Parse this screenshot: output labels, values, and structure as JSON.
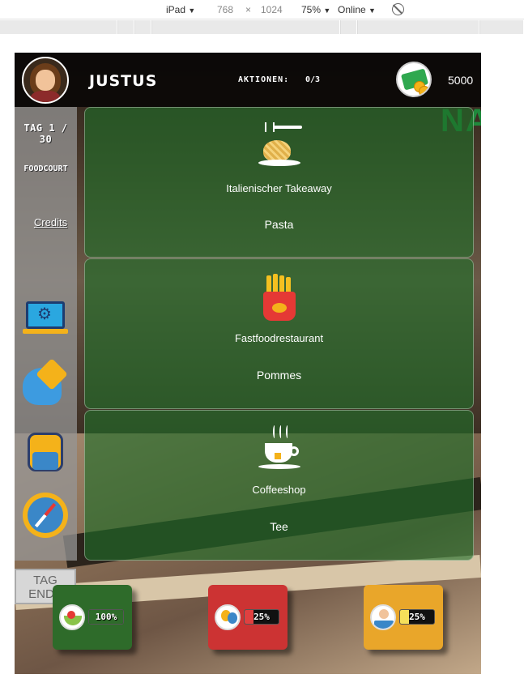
{
  "devtools": {
    "device": "iPad",
    "width": "768",
    "times": "×",
    "height": "1024",
    "zoom": "75%",
    "network": "Online",
    "dropdown_glyph": "▼"
  },
  "header": {
    "player_name": "JUSTUS",
    "actions_label": "AKTIONEN:",
    "actions_value": "0/3",
    "money": "5000"
  },
  "sidebar": {
    "day": "TAG 1 / 30",
    "location": "FOODCOURT",
    "credits": "Credits",
    "icons": [
      "settings-laptop-icon",
      "brain-icon",
      "backpack-icon",
      "compass-icon"
    ],
    "end_day_line1": "TAG",
    "end_day_line2": "ENDE"
  },
  "shops": [
    {
      "name": "Italienischer Takeaway",
      "product": "Pasta",
      "icon": "pasta-icon"
    },
    {
      "name": "Fastfoodrestaurant",
      "product": "Pommes",
      "icon": "fries-icon"
    },
    {
      "name": "Coffeeshop",
      "product": "Tee",
      "icon": "coffee-icon"
    }
  ],
  "stats": [
    {
      "label": "100%",
      "value": 1.0,
      "icon": "food-icon",
      "color": "#2e6b2a"
    },
    {
      "label": "25%",
      "value": 0.25,
      "icon": "balloons-icon",
      "color": "#cc3333"
    },
    {
      "label": "25%",
      "value": 0.25,
      "icon": "work-icon",
      "color": "#e9a62a"
    }
  ],
  "background_sign": "NA",
  "colors": {
    "card_green": "#1e6e28",
    "header_dark": "#0a0806",
    "accent_yellow": "#f4b21a"
  }
}
